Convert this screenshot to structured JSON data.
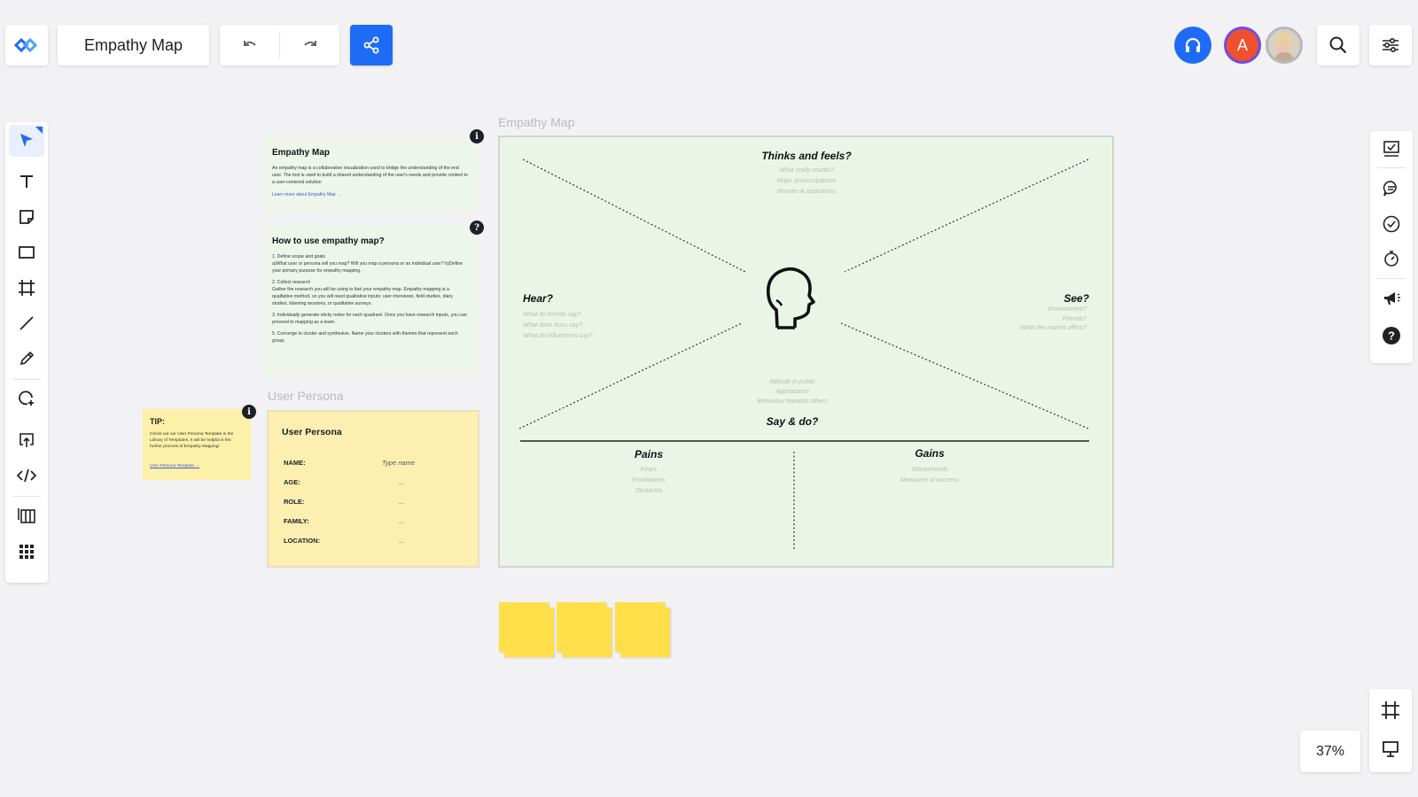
{
  "header": {
    "board_title": "Empathy Map",
    "avatar_initial": "A"
  },
  "zoom": {
    "label": "37%"
  },
  "colors": {
    "accent": "#1e6cf5",
    "avatar_a": "#f0502e",
    "map_bg": "#eaf5e7",
    "sticky": "#ffe04a",
    "note_yellow": "#fdf0a8"
  },
  "left_toolbar": [
    "select-tool",
    "text-tool",
    "sticky-note-tool",
    "shape-tool",
    "frame-tool",
    "line-tool",
    "pen-tool",
    "lasso-tool",
    "upload-tool",
    "embed-tool",
    "templates-tool",
    "apps-tool"
  ],
  "right_toolbar": [
    "board-review-icon",
    "comments-icon",
    "tasks-icon",
    "timer-icon",
    "announce-icon",
    "help-icon"
  ],
  "info_note": {
    "title": "Empathy Map",
    "body": "An empathy map is a collaborative visualization used to bridge the understanding of the end user. The tool is used to build a shared understanding of the user's needs and provide context to a user-centered solution",
    "link": "Learn more about Empathy Map →"
  },
  "howto_note": {
    "title": "How to use empathy map?",
    "steps": [
      "1. Define scope and goals\na)What user or persona will you map? Will you map a persona or an individual user? b)Define your primary purpose for empathy mapping.",
      "2. Collect research\nGather the research you will be using to fuel your empathy map. Empathy mapping is a qualitative method, so you will need qualitative inputs: user interviews, field studies, diary studies, listening sessions, or qualitative surveys.",
      "3. Individually generate sticky notes for each quadrant. Once you have research inputs, you can proceed to mapping as a team.",
      "5. Converge to cluster and synthesize. Name your clusters with themes that represent each group."
    ]
  },
  "tip_note": {
    "title": "TIP:",
    "body": "Check out our User Persona Template in the Library of Templates. It will be helpful in the further process of Empathy Mapping!",
    "link": "User Persona Template →"
  },
  "user_persona": {
    "frame_label": "User Persona",
    "title": "User Persona",
    "rows": [
      {
        "label": "NAME:",
        "value": "Type name"
      },
      {
        "label": "AGE:",
        "value": "..."
      },
      {
        "label": "ROLE:",
        "value": "..."
      },
      {
        "label": "FAMILY:",
        "value": "..."
      },
      {
        "label": "LOCATION:",
        "value": "..."
      }
    ]
  },
  "empathy_map": {
    "frame_label": "Empathy Map",
    "thinks": {
      "title": "Thinks and feels?",
      "lines": [
        "What really counts?",
        "Major preoccupations",
        "Worries & aspirations"
      ]
    },
    "hear": {
      "title": "Hear?",
      "lines": [
        "What do friends say?",
        "What does boss say?",
        "What do influencers say?"
      ]
    },
    "see": {
      "title": "See?",
      "lines": [
        "Environment?",
        "Friends?",
        "What the market offers?"
      ]
    },
    "say": {
      "title": "Say & do?",
      "lines": [
        "Attitude in public",
        "Appearance",
        "Behaviour towards others"
      ]
    },
    "pains": {
      "title": "Pains",
      "lines": [
        "Fears",
        "Frustrations",
        "Obstacles"
      ]
    },
    "gains": {
      "title": "Gains",
      "lines": [
        "Wants/needs",
        "Measures of success"
      ]
    }
  }
}
